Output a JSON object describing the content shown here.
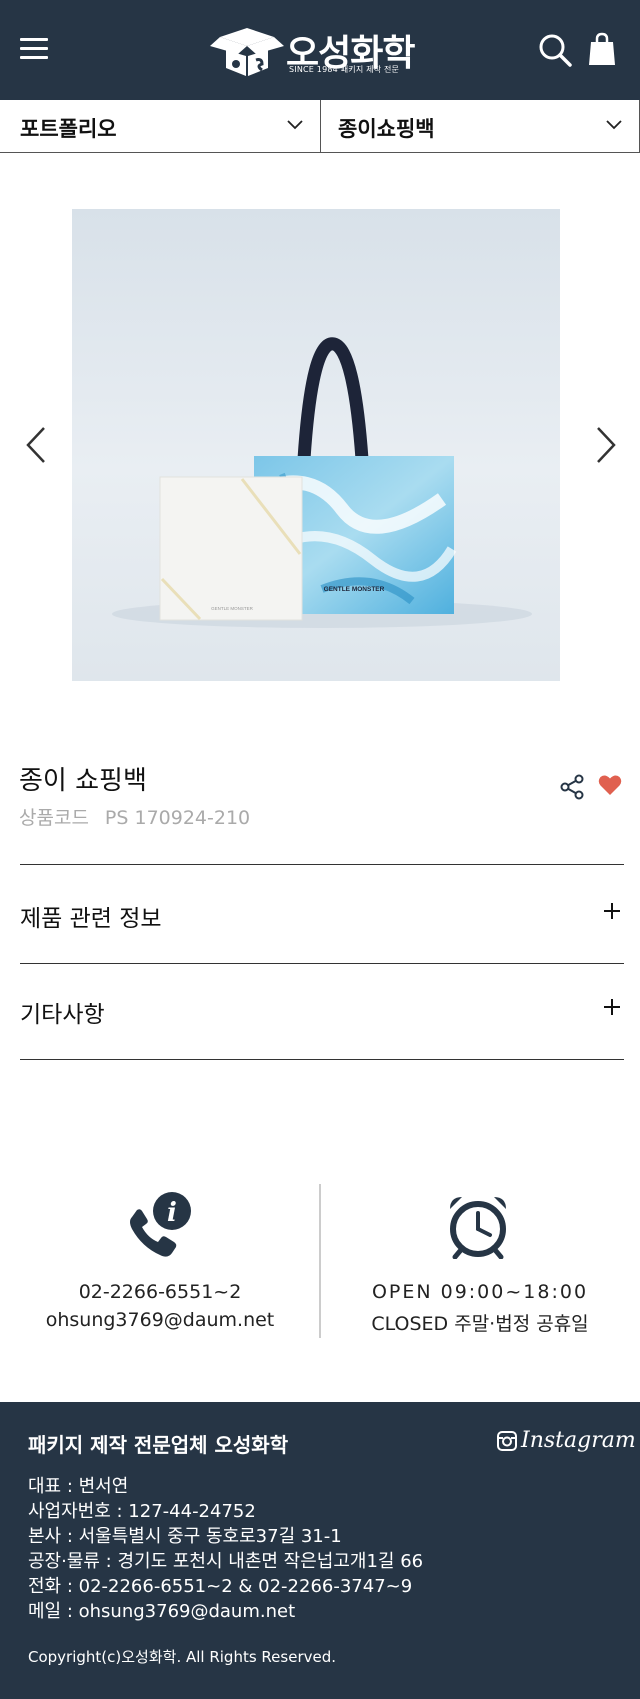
{
  "header": {
    "logo_text": "오성화학",
    "logo_sub": "SINCE 1984  패키지 제작 전문",
    "brand_color": "#263545"
  },
  "dropdowns": {
    "category": "포트폴리오",
    "subcategory": "종이쇼핑백"
  },
  "product": {
    "title": "종이 쇼핑백",
    "code_label": "상품코드",
    "code_value": "PS 170924-210",
    "image_brand_text": "GENTLE MONSTER",
    "image_box_text": "GENTLE MONSTER"
  },
  "accordion": [
    {
      "label": "제품 관련 정보"
    },
    {
      "label": "기타사항"
    }
  ],
  "contact": {
    "phone": "02-2266-6551~2",
    "email": "ohsung3769@daum.net",
    "open_hours": "OPEN 09:00~18:00",
    "closed": "CLOSED 주말·법정 공휴일"
  },
  "footer": {
    "title": "패키지 제작 전문업체 오성화학",
    "instagram": "Instagram",
    "lines": [
      "대표 : 변서연",
      "사업자번호 : 127-44-24752",
      "본사 : 서울특별시 중구 동호로37길 31-1",
      "공장·물류 : 경기도 포천시 내촌면 작은넙고개1길 66",
      "전화 : 02-2266-6551~2 & 02-2266-3747~9",
      "메일 : ohsung3769@daum.net"
    ],
    "copyright": "Copyright(c)오성화학. All Rights Reserved."
  },
  "colors": {
    "heart": "#e0604f",
    "icon_dark": "#263545"
  }
}
